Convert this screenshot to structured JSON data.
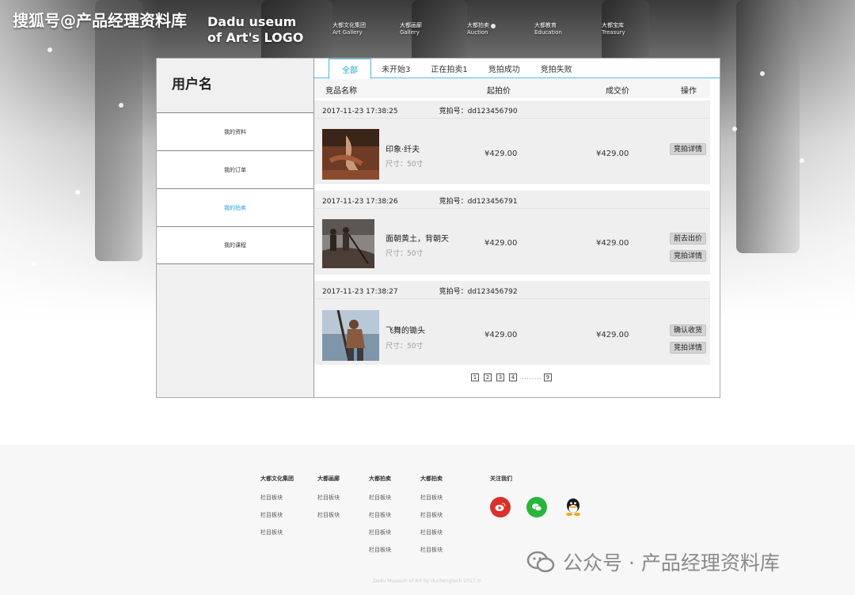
{
  "watermark_top": "搜狐号@产品经理资料库",
  "logo": {
    "line1": "Dadu useum",
    "line2": "of Art's LOGO"
  },
  "nav": [
    {
      "cn": "大都文化集团",
      "en": "Art Gallery"
    },
    {
      "cn": "大都画廊",
      "en": "Gallery"
    },
    {
      "cn": "大都拍卖",
      "en": "Auction"
    },
    {
      "cn": "大都教育",
      "en": "Education"
    },
    {
      "cn": "大都宝库",
      "en": "Treasury"
    }
  ],
  "sidebar": {
    "title": "用户名",
    "items": [
      {
        "label": "我的资料"
      },
      {
        "label": "我的订单"
      },
      {
        "label": "我的拍卖"
      },
      {
        "label": "我的课程"
      }
    ]
  },
  "tabs": [
    {
      "label": "全部"
    },
    {
      "label": "未开始3"
    },
    {
      "label": "正在拍卖1"
    },
    {
      "label": "竞拍成功"
    },
    {
      "label": "竞拍失败"
    }
  ],
  "columns": {
    "name": "竞品名称",
    "start": "起拍价",
    "deal": "成交价",
    "action": "操作"
  },
  "orders": [
    {
      "time": "2017-11-23 17:38:25",
      "no": "竞拍号：dd123456790",
      "name": "印象·纤夫",
      "size": "尺寸：50寸",
      "start": "¥429.00",
      "deal": "¥429.00",
      "btn1": "",
      "btn2": "竞拍详情"
    },
    {
      "time": "2017-11-23 17:38:26",
      "no": "竞拍号：dd123456791",
      "name": "面朝黄土，背朝天",
      "size": "尺寸：50寸",
      "start": "¥429.00",
      "deal": "¥429.00",
      "btn1": "前去出价",
      "btn2": "竞拍详情"
    },
    {
      "time": "2017-11-23 17:38:27",
      "no": "竞拍号：dd123456792",
      "name": "飞舞的锄头",
      "size": "尺寸：50寸",
      "start": "¥429.00",
      "deal": "¥429.00",
      "btn1": "确认收货",
      "btn2": "竞拍详情"
    }
  ],
  "pager": {
    "p1": "1",
    "p2": "2",
    "p3": "3",
    "p4": "4",
    "dots": "........",
    "last": "9"
  },
  "footer": {
    "cols": [
      {
        "head": "大都文化集团",
        "links": [
          "栏目板块",
          "栏目板块",
          "栏目板块"
        ]
      },
      {
        "head": "大都画廊",
        "links": [
          "栏目板块",
          "栏目板块"
        ]
      },
      {
        "head": "大都拍卖",
        "links": [
          "栏目板块",
          "栏目板块",
          "栏目板块",
          "栏目板块"
        ]
      },
      {
        "head": "大都拍卖",
        "links": [
          "栏目板块",
          "栏目板块",
          "栏目板块",
          "栏目板块"
        ]
      }
    ],
    "follow": "关注我们",
    "copyright": "Dadu Museum of Art by duchengtech 2017 ©"
  },
  "watermark_bottom": "公众号 · 产品经理资料库",
  "colors": {
    "accent": "#1aa3d9",
    "weibo": "#d9312e",
    "wechat": "#27b53b"
  }
}
